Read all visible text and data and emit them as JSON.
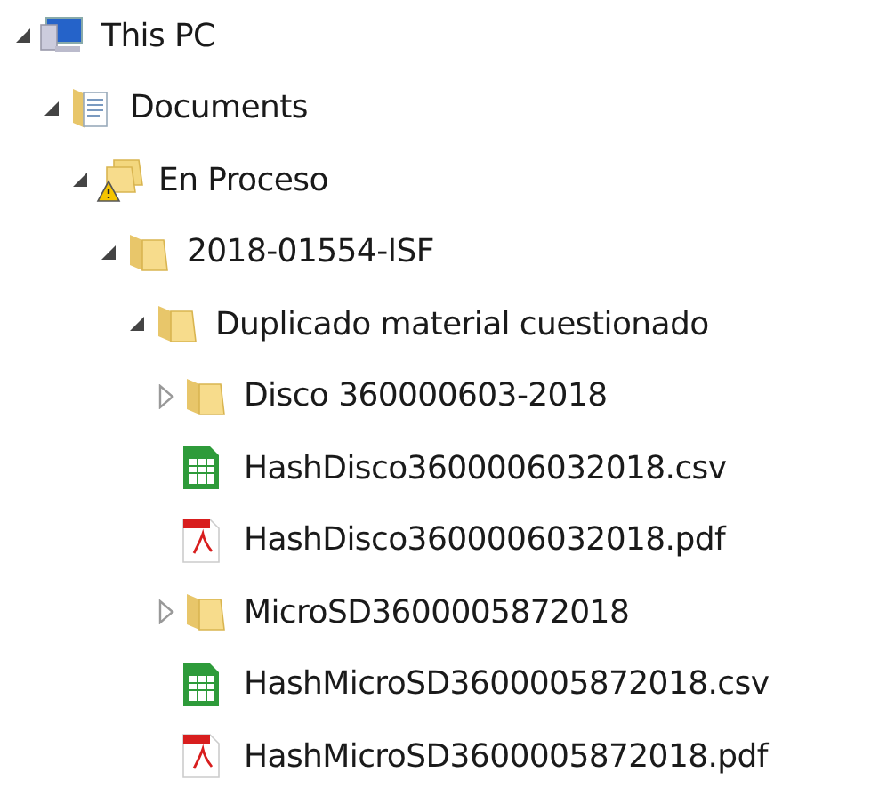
{
  "tree": [
    {
      "label": "This PC",
      "kind": "computer",
      "expanded": true,
      "children": [
        {
          "label": "Documents",
          "kind": "documents",
          "expanded": true,
          "children": [
            {
              "label": "En Proceso",
              "kind": "shared-folder",
              "expanded": true,
              "children": [
                {
                  "label": "2018-01554-ISF",
                  "kind": "folder",
                  "expanded": true,
                  "children": [
                    {
                      "label": "Duplicado material cuestionado",
                      "kind": "folder",
                      "expanded": true,
                      "children": [
                        {
                          "label": "Disco 360000603-2018",
                          "kind": "folder",
                          "expanded": false
                        },
                        {
                          "label": "HashDisco3600006032018.csv",
                          "kind": "csv"
                        },
                        {
                          "label": "HashDisco3600006032018.pdf",
                          "kind": "pdf"
                        },
                        {
                          "label": "MicroSD3600005872018",
                          "kind": "folder",
                          "expanded": false
                        },
                        {
                          "label": "HashMicroSD3600005872018.csv",
                          "kind": "csv"
                        },
                        {
                          "label": "HashMicroSD3600005872018.pdf",
                          "kind": "pdf"
                        }
                      ]
                    }
                  ]
                }
              ]
            }
          ]
        }
      ]
    }
  ]
}
